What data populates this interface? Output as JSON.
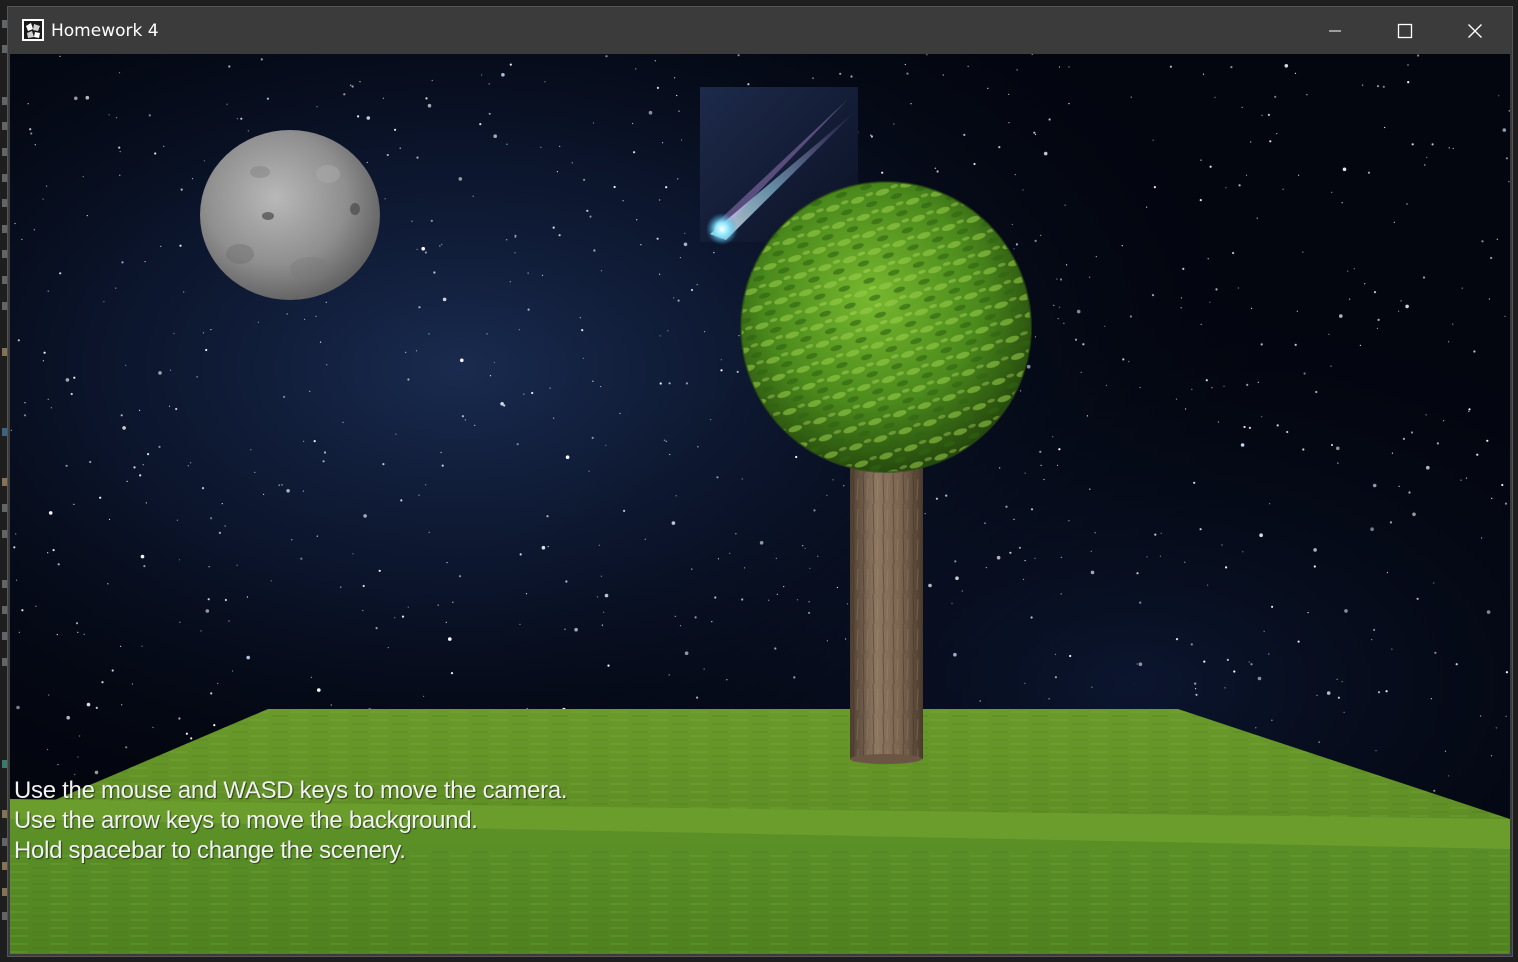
{
  "window": {
    "title": "Homework 4",
    "controls": {
      "minimize_icon": "minimize-icon",
      "maximize_icon": "maximize-icon",
      "close_icon": "close-icon"
    }
  },
  "scene": {
    "sky_color": "#03060f",
    "moon_color": "#8e8e8e",
    "foliage_color": "#4a8a1c",
    "trunk_color": "#7a6450",
    "grass_color": "#6e9f2c",
    "comet_color": "#9fe8ff"
  },
  "instructions": {
    "line1": "Use the mouse and WASD keys to move the camera.",
    "line2": "Use the arrow keys to move the background.",
    "line3": "Hold spacebar to change the scenery."
  }
}
